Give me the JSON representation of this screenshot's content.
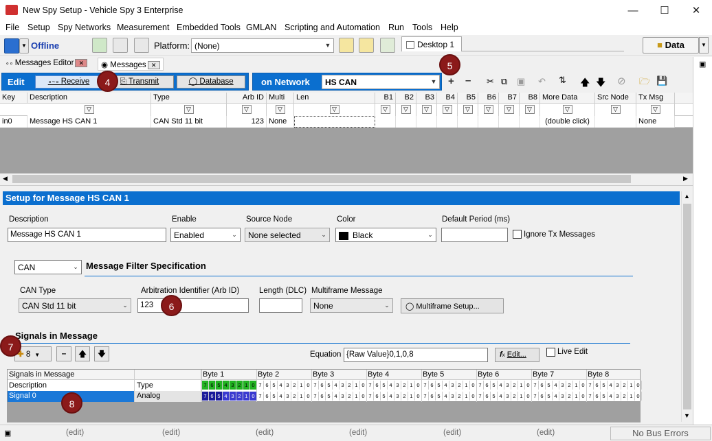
{
  "window": {
    "title": "New Spy Setup - Vehicle Spy 3 Enterprise"
  },
  "menu": [
    "File",
    "Setup",
    "Spy Networks",
    "Measurement",
    "Embedded Tools",
    "GMLAN",
    "Scripting and Automation",
    "Run",
    "Tools",
    "Help"
  ],
  "toolbar": {
    "status": "Offline",
    "platform_label": "Platform:",
    "platform_value": "(None)",
    "desktop_tab": "Desktop 1",
    "data_button": "Data"
  },
  "doc_tabs": [
    "Messages Editor",
    "Messages"
  ],
  "edit_bar": {
    "edit_label": "Edit",
    "receive": "Receive",
    "transmit": "Transmit",
    "database": "Database",
    "on_network_label": "on Network",
    "network_value": "HS CAN"
  },
  "badges": [
    "4",
    "5",
    "6",
    "7",
    "8"
  ],
  "grid": {
    "columns": [
      "Key",
      "Description",
      "Type",
      "Arb ID",
      "Multi",
      "Len",
      "B1",
      "B2",
      "B3",
      "B4",
      "B5",
      "B6",
      "B7",
      "B8",
      "More Data",
      "Src Node",
      "Tx Msg"
    ],
    "row": [
      "in0",
      "Message HS CAN 1",
      "CAN Std 11 bit",
      "123",
      "None",
      "",
      "",
      "",
      "",
      "",
      "",
      "",
      "",
      "",
      "(double click)",
      "",
      "None"
    ]
  },
  "setup": {
    "title": "Setup for Message HS CAN 1",
    "description_label": "Description",
    "description_value": "Message HS CAN 1",
    "enable_label": "Enable",
    "enable_value": "Enabled",
    "source_node_label": "Source Node",
    "source_node_value": "None selected",
    "color_label": "Color",
    "color_value": "Black",
    "default_period_label": "Default Period (ms)",
    "default_period_value": "",
    "ignore_tx_label": "Ignore Tx Messages",
    "filter_type": "CAN",
    "filter_spec_label": "Message Filter Specification",
    "can_type_label": "CAN Type",
    "can_type_value": "CAN Std 11 bit",
    "arb_id_label": "Arbitration Identifier (Arb ID)",
    "arb_id_value": "123",
    "length_label": "Length (DLC)",
    "length_value": "",
    "multiframe_label": "Multiframe Message",
    "multiframe_value": "None",
    "multiframe_setup": "Multiframe Setup..."
  },
  "signals": {
    "section_label": "Signals in Message",
    "add_count": "8",
    "equation_label": "Equation",
    "equation_value": "{Raw Value}0,1,0,8",
    "edit_button": "Edit...",
    "live_edit": "Live Edit",
    "table_header": "Signals in Message",
    "col_description": "Description",
    "col_type": "Type",
    "bytes": [
      "Byte 1",
      "Byte 2",
      "Byte 3",
      "Byte 4",
      "Byte 5",
      "Byte 6",
      "Byte 7",
      "Byte 8"
    ],
    "bits": [
      "7",
      "6",
      "5",
      "4",
      "3",
      "2",
      "1",
      "0"
    ],
    "signal_name": "Signal 0",
    "signal_type": "Analog"
  },
  "statusbar": {
    "edit_items": [
      "(edit)",
      "(edit)",
      "(edit)",
      "(edit)",
      "(edit)",
      "(edit)"
    ],
    "bus": "No Bus Errors"
  },
  "colors": {
    "accent": "#0b6fcf",
    "badge": "#8b1a1a",
    "signal_green": "#22b422",
    "signal_blue": "#3a3ad0"
  }
}
